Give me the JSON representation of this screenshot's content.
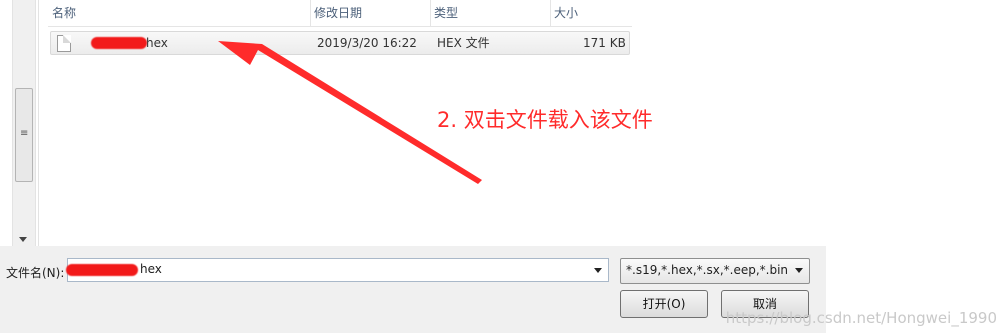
{
  "columns": {
    "name": "名称",
    "modified": "修改日期",
    "type": "类型",
    "size": "大小"
  },
  "file": {
    "name_suffix": "hex",
    "modified": "2019/3/20 16:22",
    "type": "HEX 文件",
    "size": "171 KB"
  },
  "annotation": {
    "text": "2. 双击文件载入该文件",
    "color": "#ff2b2b"
  },
  "bottom": {
    "filename_label": "文件名(N):",
    "filename_value_suffix": "hex",
    "filetype_value": "*.s19,*.hex,*.sx,*.eep,*.bin",
    "open_button": "打开(O)",
    "cancel_button": "取消"
  },
  "watermark": "https://blog.csdn.net/Hongwei_1990",
  "icons": {
    "scroll_grip": "≡"
  }
}
